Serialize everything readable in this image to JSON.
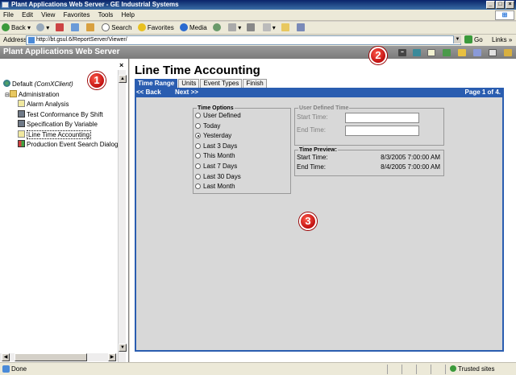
{
  "browser": {
    "window_title": "Plant Applications Web Server - GE Industrial Systems",
    "menu": [
      "File",
      "Edit",
      "View",
      "Favorites",
      "Tools",
      "Help"
    ],
    "toolbar": {
      "back": "Back",
      "search": "Search",
      "favorites": "Favorites",
      "media": "Media"
    },
    "address_label": "Address",
    "address_url": "http://bt.gsul.6/ReportServer/Viewer/",
    "go_label": "Go",
    "links_label": "Links",
    "status_text": "Done",
    "zone_text": "Trusted sites"
  },
  "app": {
    "header_title": "Plant Applications Web Server"
  },
  "tree": {
    "root": "Default",
    "root_server": "(ComXClient)",
    "folder": "Administration",
    "items": [
      {
        "label": "Alarm Analysis"
      },
      {
        "label": "Test Conformance By Shift"
      },
      {
        "label": "Specification By Variable"
      },
      {
        "label": "Line Time Accounting"
      },
      {
        "label": "Production Event Search Dialog"
      }
    ]
  },
  "report": {
    "title": "Line Time Accounting",
    "tabs": [
      "Time Range",
      "Units",
      "Event Types",
      "Finish"
    ],
    "active_tab": "Time Range",
    "back_label": "<< Back",
    "next_label": "Next >>",
    "page_indicator": "Page 1 of 4.",
    "time_options": {
      "legend": "Time Options",
      "options": [
        "User Defined",
        "Today",
        "Yesterday",
        "Last 3 Days",
        "This Month",
        "Last 7 Days",
        "Last 30 Days",
        "Last Month"
      ],
      "selected": "Yesterday"
    },
    "user_defined": {
      "legend": "User Defined Time",
      "start_label": "Start Time:",
      "end_label": "End Time:",
      "start_value": "",
      "end_value": ""
    },
    "preview": {
      "legend": "Time Preview:",
      "start_label": "Start Time:",
      "start_value": "8/3/2005 7:00:00 AM",
      "end_label": "End Time:",
      "end_value": "8/4/2005 7:00:00 AM"
    }
  },
  "callouts": [
    "1",
    "2",
    "3"
  ],
  "colors": {
    "accent": "#2a5db0",
    "header_gray": "#8a8a8a",
    "callout_red": "#d01a1a"
  }
}
